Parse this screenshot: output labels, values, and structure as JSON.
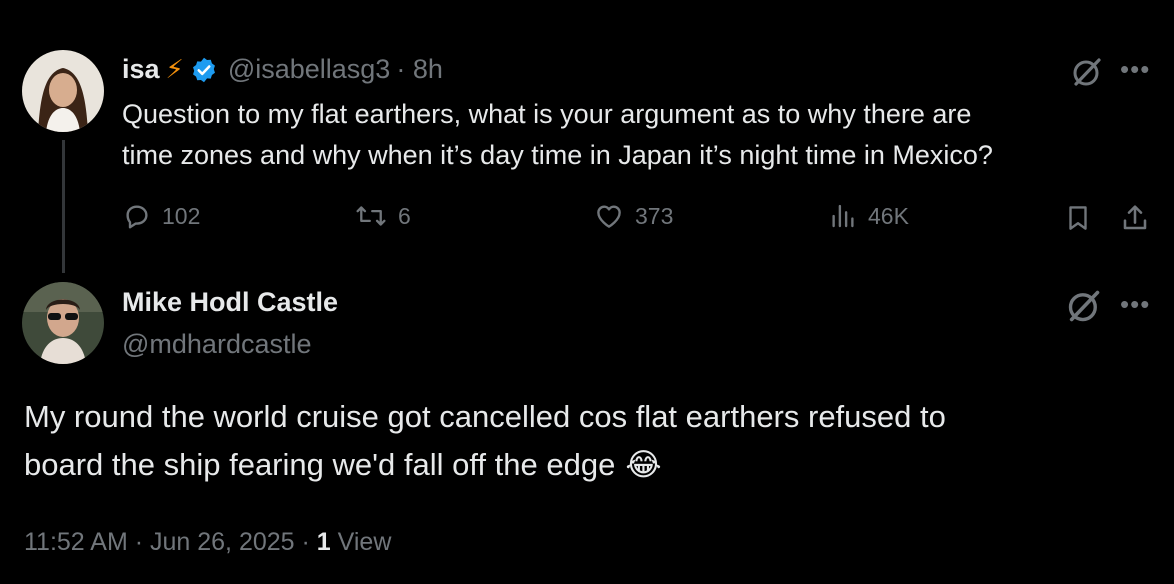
{
  "tweet1": {
    "name": "isa",
    "name_emoji": "⚡",
    "handle": "@isabellasg3",
    "time": "· 8h",
    "text_line1": "Question to my flat earthers, what is your argument as to why there are",
    "text_line2": "time zones and why when it’s day time in Japan it’s night time in Mexico?",
    "replies": "102",
    "reposts": "6",
    "likes": "373",
    "views": "46K"
  },
  "tweet2": {
    "name": "Mike Hodl Castle",
    "handle": "@mdhardcastle",
    "text_line1": "My round the world cruise got cancelled cos flat earthers refused to",
    "text_line2": "board the ship fearing we'd fall off the edge",
    "emoji": "😂",
    "timestamp": "11:52 AM · Jun 26, 2025 ·",
    "view_count": "1",
    "view_label": "View"
  },
  "colors": {
    "background": "#000000",
    "text": "#e7e9ea",
    "muted": "#71767b",
    "verified": "#1d9bf0",
    "lightning": "#f4900c"
  },
  "icons": [
    "verified-badge-icon",
    "grok-icon",
    "more-icon",
    "reply-icon",
    "repost-icon",
    "like-icon",
    "views-icon",
    "bookmark-icon",
    "share-icon"
  ]
}
